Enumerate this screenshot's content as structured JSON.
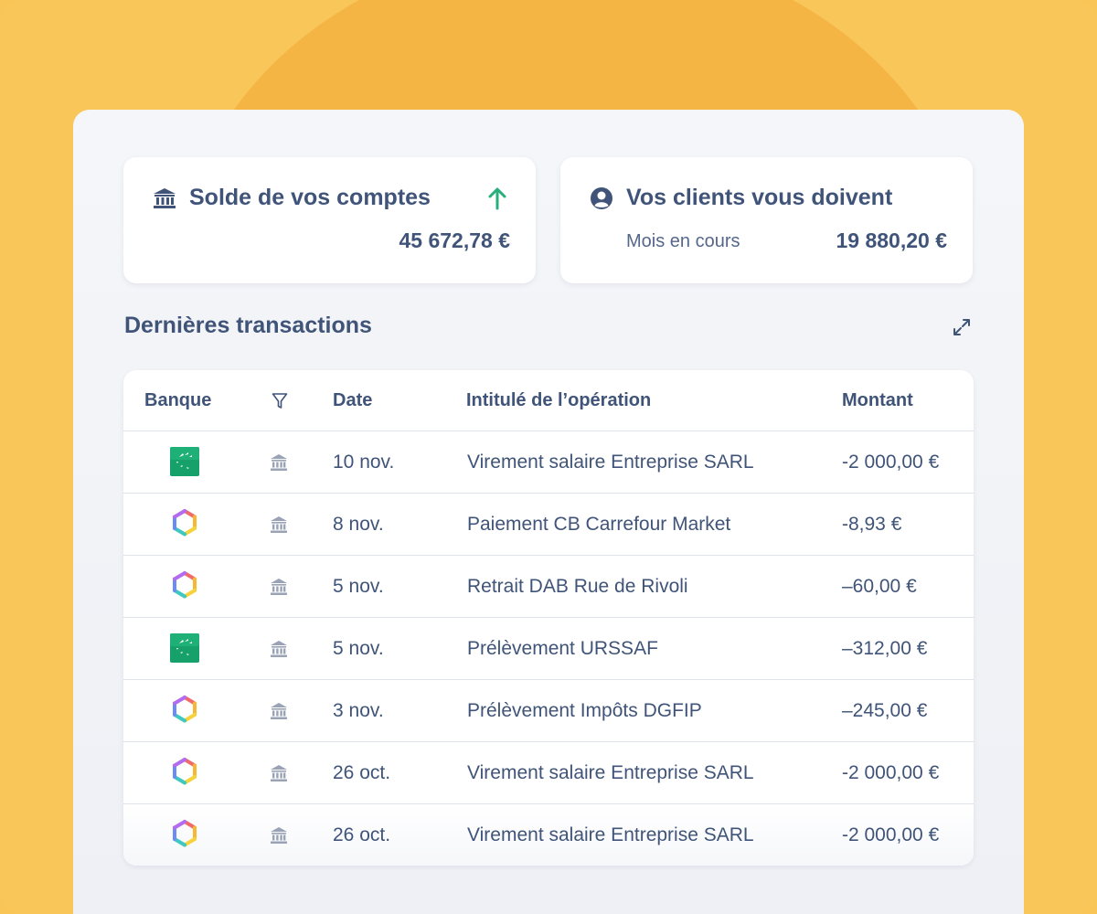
{
  "balance_card": {
    "title": "Solde de vos comptes",
    "amount": "45 672,78 €",
    "icon": "bank-icon",
    "trend_icon": "arrow-up-icon"
  },
  "clients_card": {
    "title": "Vos clients vous doivent",
    "period": "Mois en cours",
    "amount": "19 880,20 €",
    "icon": "user-circle-icon"
  },
  "transactions": {
    "title": "Dernières transactions",
    "expand_icon": "expand-icon",
    "columns": {
      "bank": "Banque",
      "date": "Date",
      "label": "Intitulé de l’opération",
      "amount": "Montant"
    },
    "rows": [
      {
        "bank": "green-bank",
        "date": "10 nov.",
        "label": "Virement salaire Entreprise SARL",
        "amount": "-2 000,00 €"
      },
      {
        "bank": "hexagon-bank",
        "date": "8 nov.",
        "label": "Paiement CB Carrefour Market",
        "amount": "-8,93 €"
      },
      {
        "bank": "hexagon-bank",
        "date": "5 nov.",
        "label": "Retrait DAB Rue de Rivoli",
        "amount": "–60,00 €"
      },
      {
        "bank": "green-bank",
        "date": "5 nov.",
        "label": "Prélèvement URSSAF",
        "amount": "–312,00 €"
      },
      {
        "bank": "hexagon-bank",
        "date": "3 nov.",
        "label": "Prélèvement Impôts DGFIP",
        "amount": "–245,00 €"
      },
      {
        "bank": "hexagon-bank",
        "date": "26 oct.",
        "label": "Virement salaire Entreprise SARL",
        "amount": "-2 000,00 €"
      },
      {
        "bank": "hexagon-bank",
        "date": "26 oct.",
        "label": "Virement salaire Entreprise SARL",
        "amount": "-2 000,00 €"
      }
    ]
  },
  "colors": {
    "text": "#3f5478",
    "accent_up": "#27b07a",
    "background": "#f9c65a",
    "bank_green": "#16a06a"
  }
}
